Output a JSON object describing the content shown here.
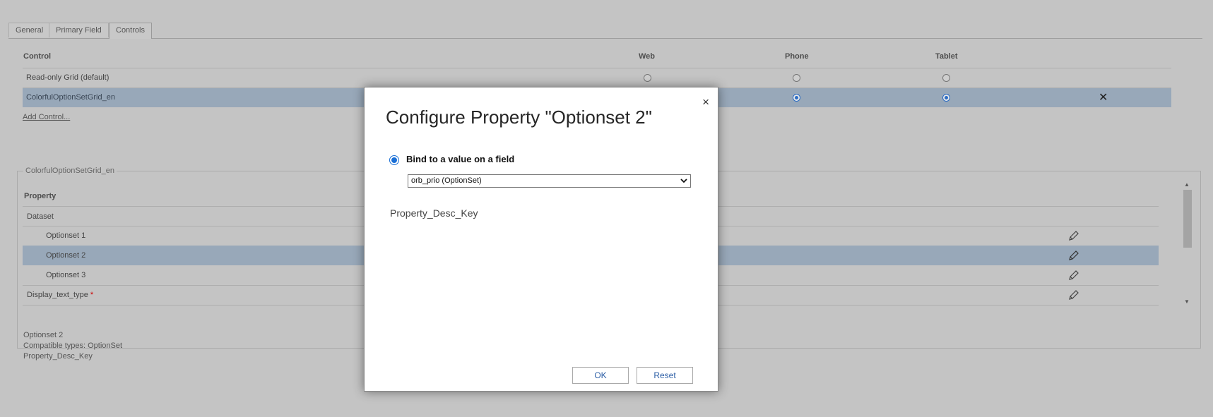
{
  "tabs": [
    "General",
    "Primary Field",
    "Controls"
  ],
  "controls_grid": {
    "headers": {
      "control": "Control",
      "web": "Web",
      "phone": "Phone",
      "tablet": "Tablet"
    },
    "rows": [
      {
        "name": "Read-only Grid (default)",
        "web": false,
        "phone": false,
        "tablet": false
      },
      {
        "name": "ColorfulOptionSetGrid_en",
        "web": true,
        "phone": true,
        "tablet": true
      }
    ],
    "add_link": "Add Control..."
  },
  "properties": {
    "legend": "ColorfulOptionSetGrid_en",
    "header": "Property",
    "rows": [
      {
        "label": "Dataset",
        "indent": false,
        "required": false
      },
      {
        "label": "Optionset 1",
        "indent": true,
        "required": false
      },
      {
        "label": "Optionset 2",
        "indent": true,
        "required": false
      },
      {
        "label": "Optionset 3",
        "indent": true,
        "required": false
      },
      {
        "label": "Display_text_type",
        "indent": false,
        "required": true
      }
    ],
    "required_marker": "*",
    "info": {
      "name": "Optionset 2",
      "types": "Compatible types: OptionSet",
      "key": "Property_Desc_Key"
    }
  },
  "dialog": {
    "close": "×",
    "title": "Configure Property \"Optionset 2\"",
    "bind_label": "Bind to a value on a field",
    "select_value": "orb_prio (OptionSet)",
    "description": "Property_Desc_Key",
    "ok": "OK",
    "reset": "Reset"
  },
  "icons": {
    "remove": "close-x-icon",
    "edit": "pencil-icon"
  },
  "colors": {
    "selected_row": "#98a8b9",
    "overlay": "#c4c4c4",
    "accent": "#1a6fd6"
  }
}
